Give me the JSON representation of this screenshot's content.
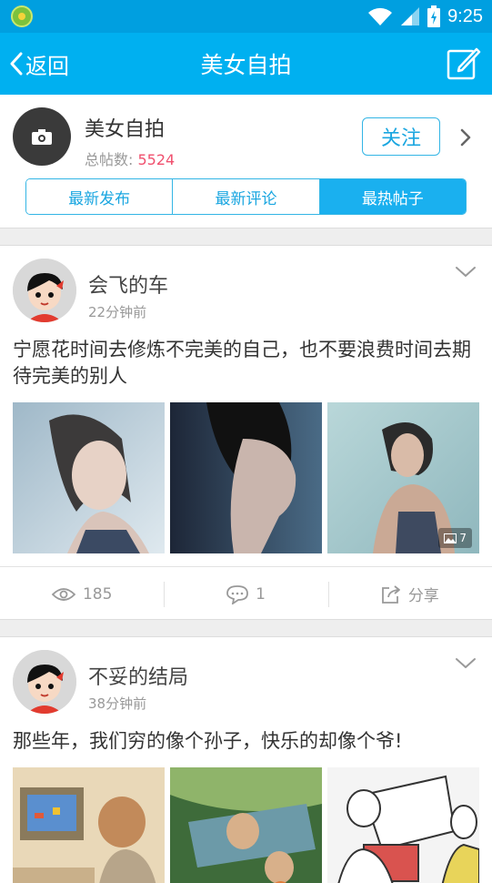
{
  "status_bar": {
    "time": "9:25"
  },
  "nav": {
    "back_label": "返回",
    "title": "美女自拍"
  },
  "forum": {
    "name": "美女自拍",
    "post_count_label": "总帖数: ",
    "post_count": "5524",
    "follow_label": "关注",
    "tabs": [
      "最新发布",
      "最新评论",
      "最热帖子"
    ],
    "active_tab": "最热帖子"
  },
  "posts": [
    {
      "author": "会飞的车",
      "time": "22分钟前",
      "text": "宁愿花时间去修炼不完美的自己，也不要浪费时间去期待完美的别人",
      "image_count": "7",
      "views": "185",
      "comments": "1",
      "share_label": "分享"
    },
    {
      "author": "不妥的结局",
      "time": "38分钟前",
      "text": "那些年，我们穷的像个孙子，快乐的却像个爷!"
    }
  ],
  "colors": {
    "status_bar": "#009fe0",
    "nav_bar": "#00b0f0",
    "accent": "#1ab0ef",
    "count_red": "#f0506e"
  }
}
